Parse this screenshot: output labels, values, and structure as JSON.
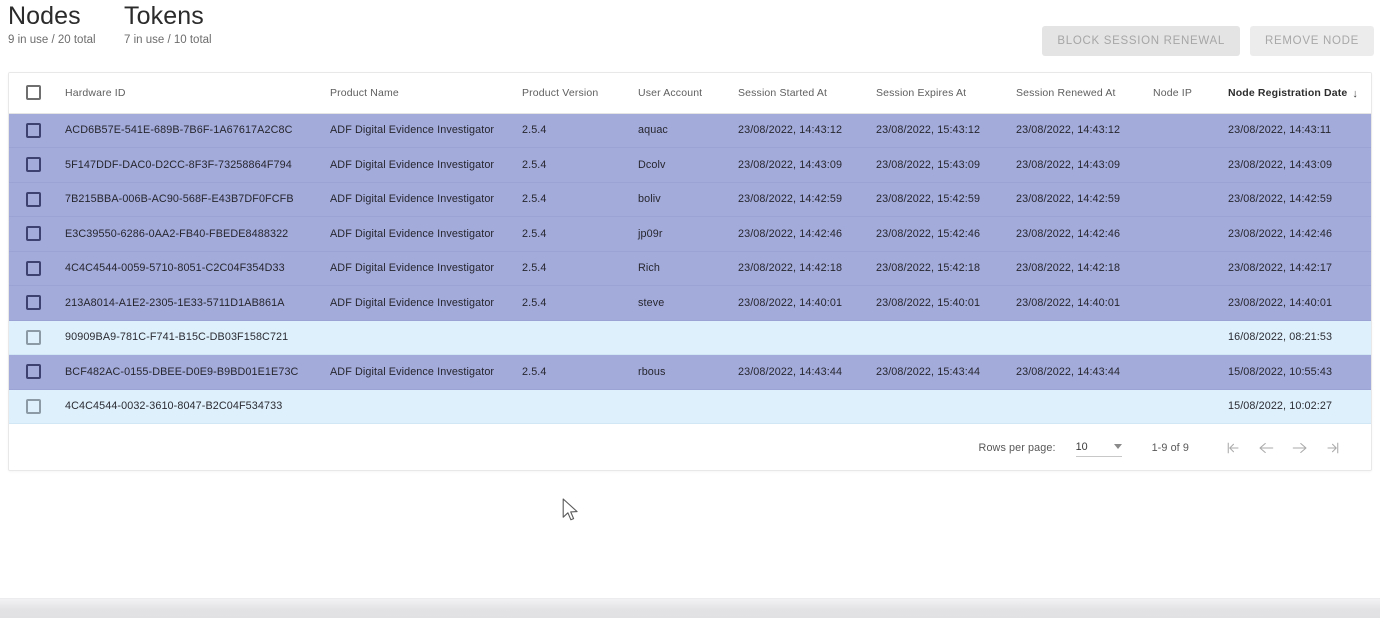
{
  "header": {
    "stats": [
      {
        "title": "Nodes",
        "subtitle": "9 in use / 20 total"
      },
      {
        "title": "Tokens",
        "subtitle": "7 in use / 10 total"
      }
    ],
    "actions": [
      {
        "label": "BLOCK SESSION RENEWAL"
      },
      {
        "label": "REMOVE NODE"
      }
    ]
  },
  "table": {
    "columns": [
      {
        "key": "hardware_id",
        "label": "Hardware ID",
        "sorted": false
      },
      {
        "key": "product_name",
        "label": "Product Name",
        "sorted": false
      },
      {
        "key": "product_version",
        "label": "Product Version",
        "sorted": false
      },
      {
        "key": "user_account",
        "label": "User Account",
        "sorted": false
      },
      {
        "key": "session_started",
        "label": "Session Started At",
        "sorted": false
      },
      {
        "key": "session_expires",
        "label": "Session Expires At",
        "sorted": false
      },
      {
        "key": "session_renewed",
        "label": "Session Renewed At",
        "sorted": false
      },
      {
        "key": "node_ip",
        "label": "Node IP",
        "sorted": false
      },
      {
        "key": "node_registration",
        "label": "Node Registration Date",
        "sorted": true
      }
    ],
    "sort_indicator": "↓",
    "rows": [
      {
        "highlighted": true,
        "hardware_id": "ACD6B57E-541E-689B-7B6F-1A67617A2C8C",
        "product_name": "ADF Digital Evidence Investigator",
        "product_version": "2.5.4",
        "user_account": "aquac",
        "session_started": "23/08/2022, 14:43:12",
        "session_expires": "23/08/2022, 15:43:12",
        "session_renewed": "23/08/2022, 14:43:12",
        "node_ip": "",
        "node_registration": "23/08/2022, 14:43:11"
      },
      {
        "highlighted": true,
        "hardware_id": "5F147DDF-DAC0-D2CC-8F3F-73258864F794",
        "product_name": "ADF Digital Evidence Investigator",
        "product_version": "2.5.4",
        "user_account": "Dcolv",
        "session_started": "23/08/2022, 14:43:09",
        "session_expires": "23/08/2022, 15:43:09",
        "session_renewed": "23/08/2022, 14:43:09",
        "node_ip": "",
        "node_registration": "23/08/2022, 14:43:09"
      },
      {
        "highlighted": true,
        "hardware_id": "7B215BBA-006B-AC90-568F-E43B7DF0FCFB",
        "product_name": "ADF Digital Evidence Investigator",
        "product_version": "2.5.4",
        "user_account": "boliv",
        "session_started": "23/08/2022, 14:42:59",
        "session_expires": "23/08/2022, 15:42:59",
        "session_renewed": "23/08/2022, 14:42:59",
        "node_ip": "",
        "node_registration": "23/08/2022, 14:42:59"
      },
      {
        "highlighted": true,
        "hardware_id": "E3C39550-6286-0AA2-FB40-FBEDE8488322",
        "product_name": "ADF Digital Evidence Investigator",
        "product_version": "2.5.4",
        "user_account": "jp09r",
        "session_started": "23/08/2022, 14:42:46",
        "session_expires": "23/08/2022, 15:42:46",
        "session_renewed": "23/08/2022, 14:42:46",
        "node_ip": "",
        "node_registration": "23/08/2022, 14:42:46"
      },
      {
        "highlighted": true,
        "hardware_id": "4C4C4544-0059-5710-8051-C2C04F354D33",
        "product_name": "ADF Digital Evidence Investigator",
        "product_version": "2.5.4",
        "user_account": "Rich",
        "session_started": "23/08/2022, 14:42:18",
        "session_expires": "23/08/2022, 15:42:18",
        "session_renewed": "23/08/2022, 14:42:18",
        "node_ip": "",
        "node_registration": "23/08/2022, 14:42:17"
      },
      {
        "highlighted": true,
        "hardware_id": "213A8014-A1E2-2305-1E33-5711D1AB861A",
        "product_name": "ADF Digital Evidence Investigator",
        "product_version": "2.5.4",
        "user_account": "steve",
        "session_started": "23/08/2022, 14:40:01",
        "session_expires": "23/08/2022, 15:40:01",
        "session_renewed": "23/08/2022, 14:40:01",
        "node_ip": "",
        "node_registration": "23/08/2022, 14:40:01"
      },
      {
        "highlighted": false,
        "hardware_id": "90909BA9-781C-F741-B15C-DB03F158C721",
        "product_name": "",
        "product_version": "",
        "user_account": "",
        "session_started": "",
        "session_expires": "",
        "session_renewed": "",
        "node_ip": "",
        "node_registration": "16/08/2022, 08:21:53"
      },
      {
        "highlighted": true,
        "hardware_id": "BCF482AC-0155-DBEE-D0E9-B9BD01E1E73C",
        "product_name": "ADF Digital Evidence Investigator",
        "product_version": "2.5.4",
        "user_account": "rbous",
        "session_started": "23/08/2022, 14:43:44",
        "session_expires": "23/08/2022, 15:43:44",
        "session_renewed": "23/08/2022, 14:43:44",
        "node_ip": "",
        "node_registration": "15/08/2022, 10:55:43"
      },
      {
        "highlighted": false,
        "hardware_id": "4C4C4544-0032-3610-8047-B2C04F534733",
        "product_name": "",
        "product_version": "",
        "user_account": "",
        "session_started": "",
        "session_expires": "",
        "session_renewed": "",
        "node_ip": "",
        "node_registration": "15/08/2022, 10:02:27"
      }
    ]
  },
  "paginator": {
    "rows_per_page_label": "Rows per page:",
    "rows_per_page_value": "10",
    "range_label": "1-9 of 9",
    "buttons": [
      {
        "name": "first-page",
        "glyph": "|←"
      },
      {
        "name": "previous-page",
        "glyph": "←"
      },
      {
        "name": "next-page",
        "glyph": "→"
      },
      {
        "name": "last-page",
        "glyph": "→|"
      }
    ]
  },
  "colors": {
    "row_highlight": "#a3abdb",
    "row_alternate": "#def0fb",
    "button_disabled": "#e4e4e4"
  }
}
